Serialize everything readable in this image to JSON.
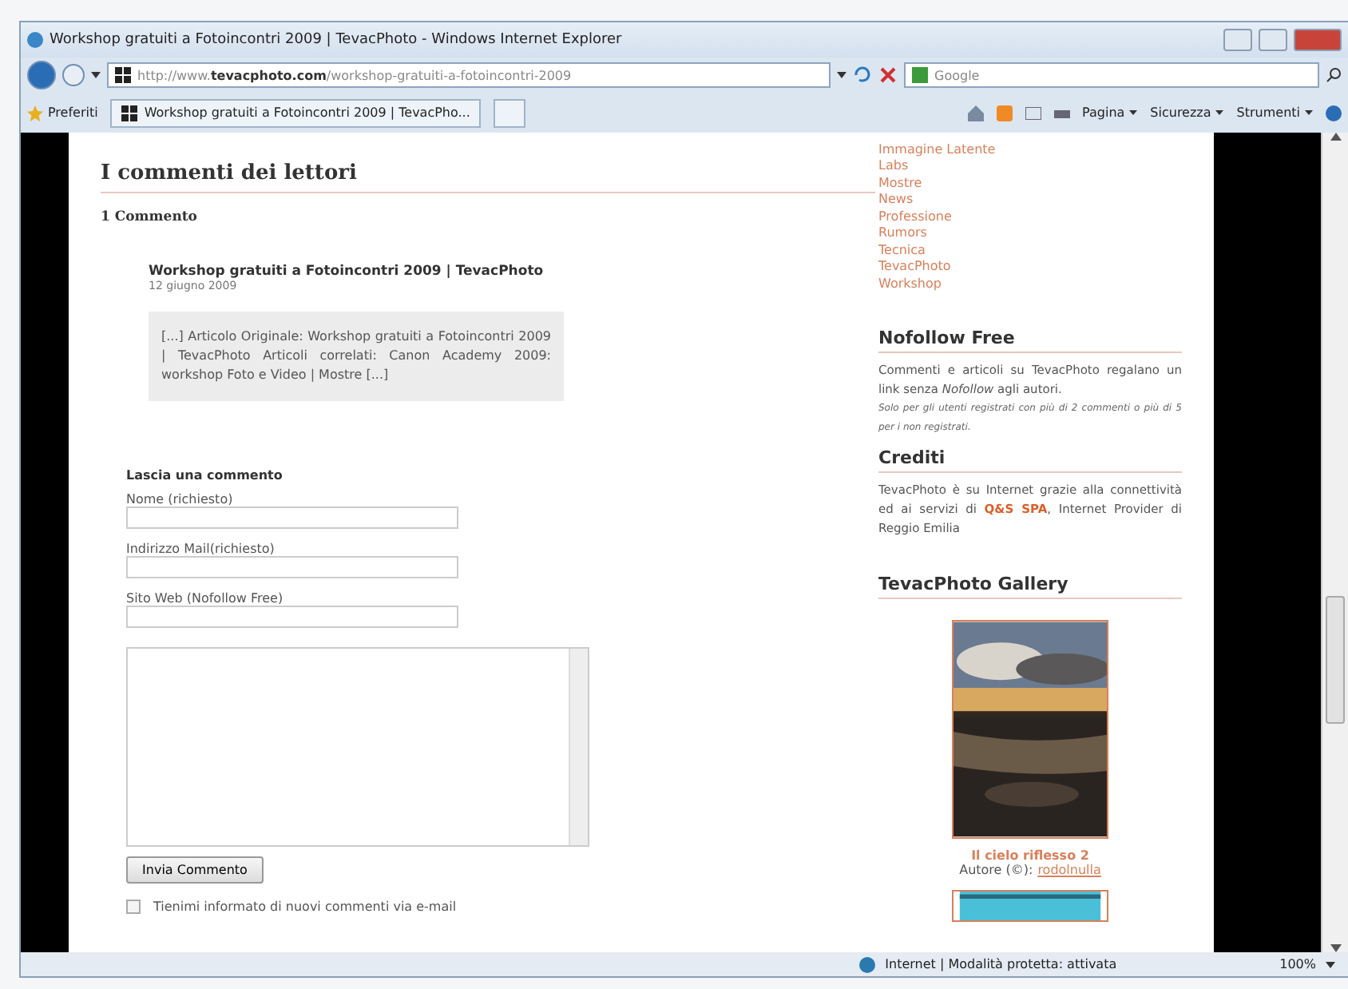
{
  "window": {
    "title": "Workshop gratuiti a Fotoincontri 2009 | TevacPhoto - Windows Internet Explorer"
  },
  "address_bar": {
    "url": "http://www.**tevacphoto.com**/workshop-gratuiti-a-fotoincontri-2009",
    "search_placeholder": "Google"
  },
  "favorites_bar": {
    "favorites": "Preferiti",
    "tab": "Workshop gratuiti a Fotoincontri 2009 | TevacPho...",
    "tools": [
      "Pagina",
      "Sicurezza",
      "Strumenti"
    ]
  },
  "comments": {
    "heading": "I commenti dei lettori",
    "count": "1 Commento",
    "items": [
      {
        "title": "Workshop gratuiti a Fotoincontri 2009 | TevacPhoto",
        "date": "12 giugno 2009",
        "text": "[...] Articolo Originale: Workshop gratuiti a Fotoincontri 2009 | TevacPhoto Articoli correlati: Canon Academy 2009: workshop Foto e Video | Mostre [...]"
      }
    ]
  },
  "form": {
    "heading": "Lascia una commento",
    "fields": [
      {
        "label": "Nome (richiesto)"
      },
      {
        "label": "Indirizzo Mail(richiesto)"
      },
      {
        "label": "Sito Web (Nofollow Free)"
      }
    ],
    "submit": "Invia Commento",
    "notify": {
      "label": "Tienimi informato di nuovi commenti via e-mail",
      "checked": false
    }
  },
  "sidebar": {
    "categories": [
      "Immagine Latente",
      "Labs",
      "Mostre",
      "News",
      "Professione",
      "Rumors",
      "Tecnica",
      "TevacPhoto",
      "Workshop"
    ],
    "nofollow": {
      "title": "Nofollow Free",
      "text": "Commenti e articoli su TevacPhoto regalano un link senza *Nofollow* agli autori.",
      "note": "Solo per gli utenti registrati con più di 2 commenti o più di 5 per i non registrati."
    },
    "credits": {
      "title": "Crediti",
      "text": "TevacPhoto è su Internet grazie alla connettività ed ai servizi di **Q&S SPA**, Internet Provider di Reggio Emilia"
    },
    "gallery": {
      "title": "TevacPhoto Gallery",
      "photo_title": "Il cielo riflesso 2",
      "author_label": "Autore (©):",
      "author": "rodolnulla"
    }
  },
  "status_bar": {
    "zone": "Internet | Modalità protetta: attivata",
    "zoom": "100%"
  }
}
